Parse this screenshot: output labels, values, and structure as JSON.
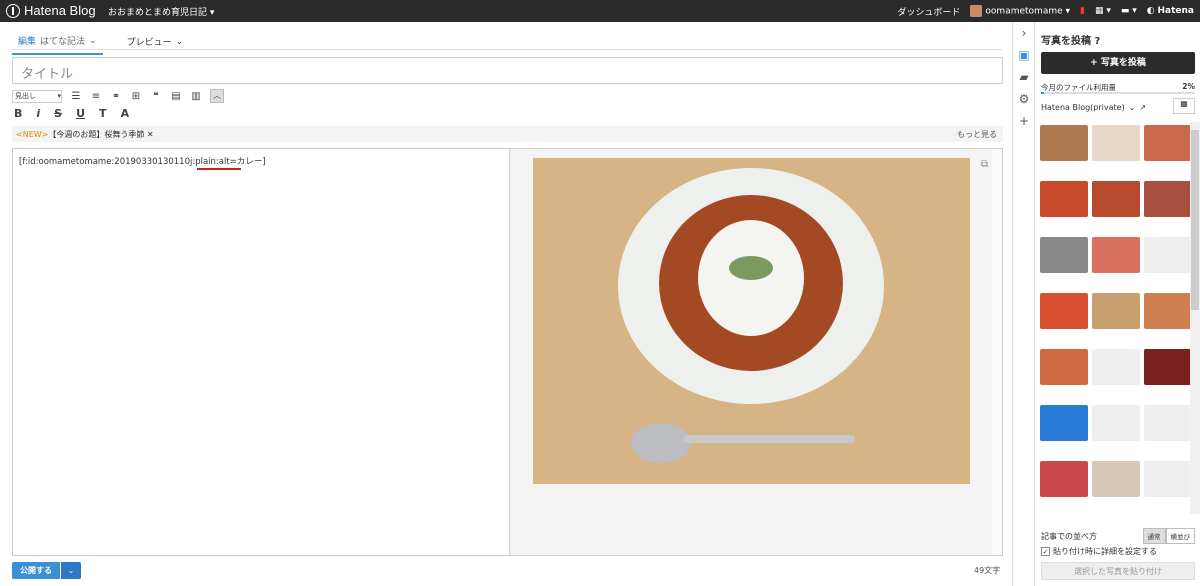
{
  "topbar": {
    "logo": "Hatena Blog",
    "blog_name": "おおまめとまめ育児日記",
    "dashboard": "ダッシュボード",
    "user": "oomametomame",
    "hatena": "Hatena"
  },
  "tabs": [
    {
      "label": "編集",
      "sub": "はてな記法"
    },
    {
      "label": "プレビュー"
    }
  ],
  "title_placeholder": "タイトル",
  "toolbar": {
    "heading": "見出し",
    "icons": [
      "bullet-list",
      "numbered-list",
      "link",
      "table-embed",
      "quote",
      "table",
      "format"
    ]
  },
  "format": [
    "B",
    "i",
    "S",
    "U",
    "T",
    "A"
  ],
  "theme": {
    "new": "<NEW>",
    "text": "【今週のお題】桜舞う季節",
    "more": "もっと見る"
  },
  "editor_text": "[f:id:oomametomame:20190330130110j:plain:alt=カレー]",
  "char_count": "49文字",
  "publish": "公開する",
  "side": {
    "title": "写真を投稿",
    "post_button": "写真を投稿",
    "usage_label": "今月のファイル利用量",
    "usage_pct": "2%",
    "usage_value": 0.02,
    "album": "Hatena Blog(private)",
    "sort_label": "記事での並べ方",
    "sort_normal": "通常",
    "sort_side": "横並び",
    "detail_label": "貼り付け時に詳細を設定する",
    "paste_button": "選択した写真を貼り付け"
  },
  "thumb_colors": [
    "#b07a50",
    "#e8d8c8",
    "#c96a4a",
    "#c84a2a",
    "#b84a30",
    "#a85040",
    "#888",
    "#d87060",
    "#eee",
    "#d85030",
    "#c8a070",
    "#d08050",
    "#d06a40",
    "#eee",
    "#7a2020",
    "#2a7ad8",
    "#eee",
    "#eee",
    "#c84a4a",
    "#d8c8b8",
    "#eee"
  ]
}
